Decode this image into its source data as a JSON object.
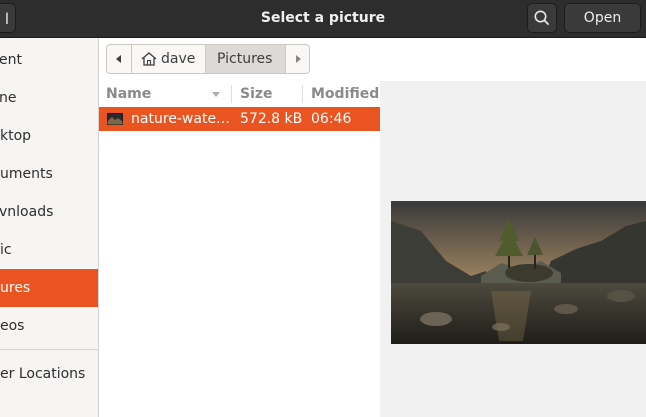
{
  "header": {
    "left_button_label": "l",
    "title": "Select a picture",
    "open_label": "Open"
  },
  "sidebar": {
    "items": [
      {
        "label": "ent"
      },
      {
        "label": "ne"
      },
      {
        "label": "ktop"
      },
      {
        "label": "uments"
      },
      {
        "label": "vnloads"
      },
      {
        "label": "ic"
      },
      {
        "label": "ures",
        "active": true
      },
      {
        "label": "eos"
      },
      {
        "label": "er Locations"
      }
    ]
  },
  "pathbar": {
    "home_label": "dave",
    "current_label": "Pictures"
  },
  "filelist": {
    "columns": [
      "Name",
      "Size",
      "Modified"
    ],
    "rows": [
      {
        "name": "nature-wate…",
        "size": "572.8 kB",
        "modified": "06:46",
        "selected": true
      }
    ]
  },
  "colors": {
    "accent": "#e95420",
    "header_bg": "#2d2d2d",
    "sidebar_bg": "#f6f5f4",
    "preview_bg": "#f1f1f1"
  }
}
